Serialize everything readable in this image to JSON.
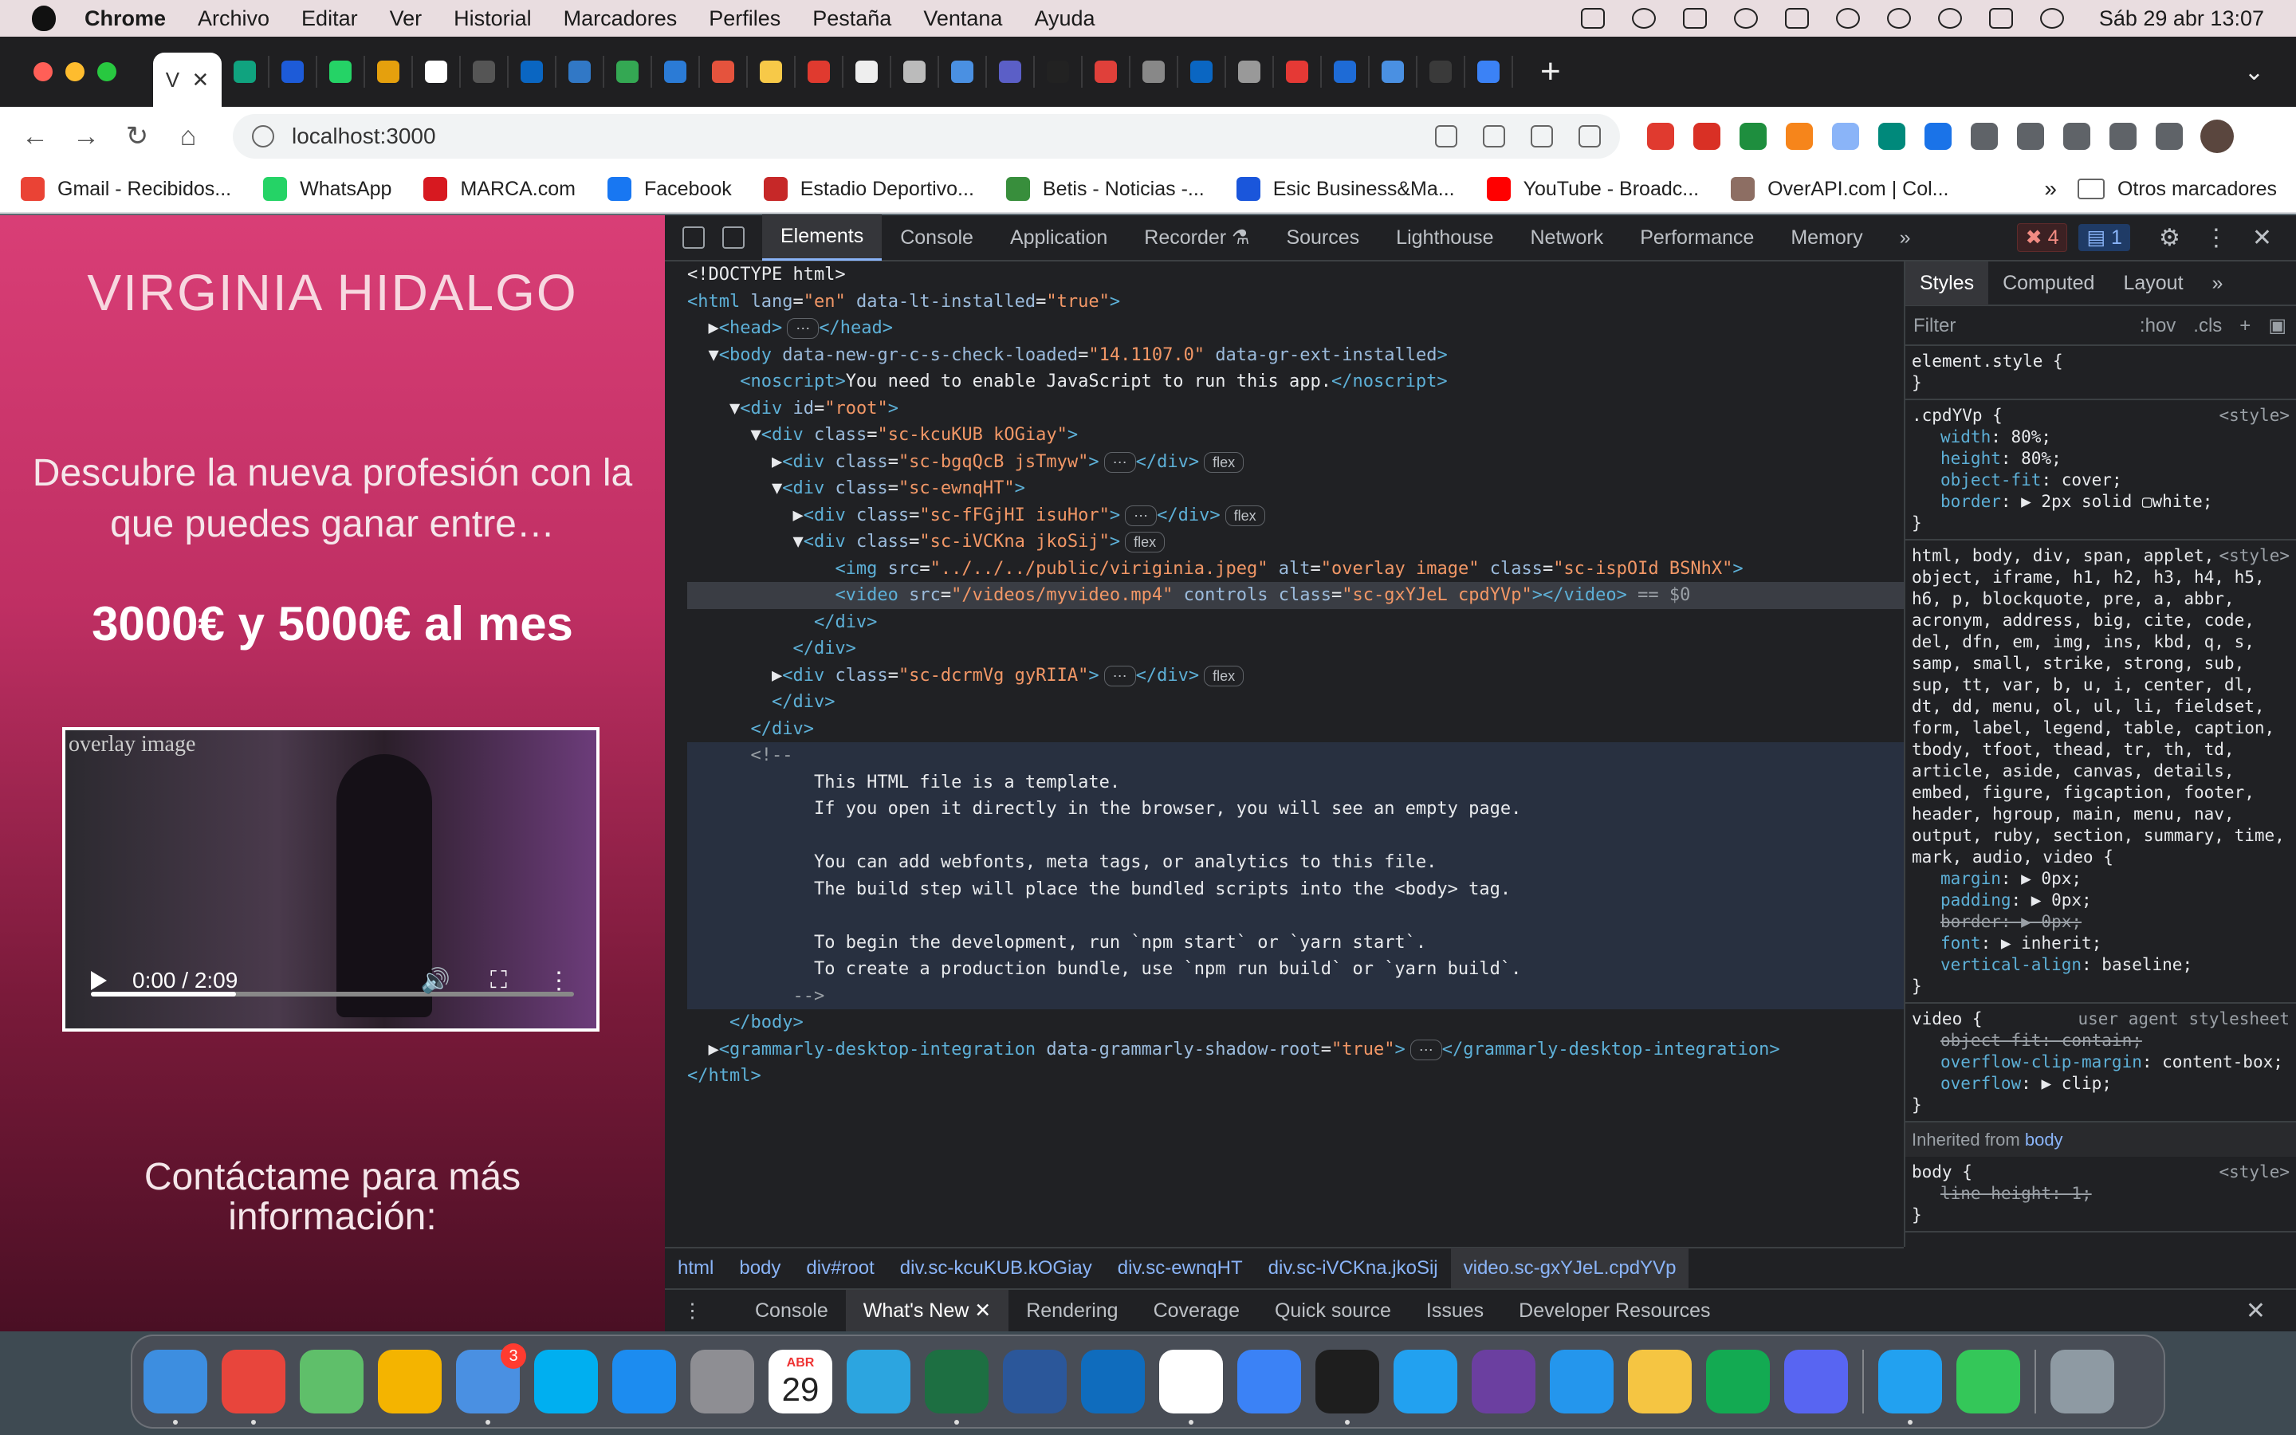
{
  "menubar": {
    "app": "Chrome",
    "items": [
      "Archivo",
      "Editar",
      "Ver",
      "Historial",
      "Marcadores",
      "Perfiles",
      "Pestaña",
      "Ventana",
      "Ayuda"
    ],
    "clock": "Sáb 29 abr 13:07"
  },
  "tabstrip": {
    "active_tab_title": "V",
    "active_tab_close": "✕",
    "new_tab": "+",
    "tab_menu": "⌄",
    "tab_icon_colors": [
      "#10a37f",
      "#1d5bd8",
      "#25d366",
      "#e5a00d",
      "#fff",
      "#555",
      "#0a66c2",
      "#3178c6",
      "#34a853",
      "#2b7bd6",
      "#e5533d",
      "#f7c948",
      "#e03a2f",
      "#eee",
      "#bbb",
      "#4a90e2",
      "#5b5fc7",
      "#222",
      "#e0403a",
      "#888",
      "#0a66c2",
      "#999",
      "#e53935",
      "#1e6bd6",
      "#4a90e2",
      "#3a3a3a",
      "#3b82f6"
    ]
  },
  "toolbar": {
    "url": "localhost:3000",
    "ext_colors": [
      "#e03a2f",
      "#d93025",
      "#1e8e3e",
      "#f6851b",
      "#8ab4f8",
      "#00897b",
      "#1a73e8",
      "#5f6368",
      "#5f6368",
      "#5f6368",
      "#5f6368",
      "#5f6368"
    ]
  },
  "bookmarks": [
    {
      "label": "Gmail - Recibidos...",
      "color": "#ea4335"
    },
    {
      "label": "WhatsApp",
      "color": "#25d366"
    },
    {
      "label": "MARCA.com",
      "color": "#d71920"
    },
    {
      "label": "Facebook",
      "color": "#1877f2"
    },
    {
      "label": "Estadio Deportivo...",
      "color": "#c62828"
    },
    {
      "label": "Betis - Noticias -...",
      "color": "#388e3c"
    },
    {
      "label": "Esic Business&Ma...",
      "color": "#1a56db"
    },
    {
      "label": "YouTube - Broadc...",
      "color": "#ff0000"
    },
    {
      "label": "OverAPI.com | Col...",
      "color": "#8d6e63"
    }
  ],
  "bookmarks_more": "»",
  "bookmarks_folder": "Otros marcadores",
  "page": {
    "name": "VIRGINIA HIDALGO",
    "subtitle": "Descubre la nueva profesión con la que puedes ganar entre…",
    "amount": "3000€ y 5000€ al mes",
    "video_alt": "overlay image",
    "video_time": "0:00 / 2:09",
    "video_progress": 0.3,
    "contact": "Contáctame para más información:"
  },
  "devtools": {
    "tabs": [
      "Elements",
      "Console",
      "Application",
      "Recorder ⚗",
      "Sources",
      "Lighthouse",
      "Network",
      "Performance",
      "Memory"
    ],
    "more_tabs": "»",
    "errors": "✖ 4",
    "messages": "▤ 1",
    "dom_lines": [
      {
        "html": "<span class='txt'>&lt;!DOCTYPE html&gt;</span>"
      },
      {
        "html": "<span class='tag'>&lt;html</span> <span class='attr'>lang</span>=<span class='val'>\"en\"</span> <span class='attr'>data-lt-installed</span>=<span class='val'>\"true\"</span><span class='tag'>&gt;</span>"
      },
      {
        "html": "  <span class='txt'>▶</span><span class='tag'>&lt;head&gt;</span><span class='chip'>⋯</span><span class='tag'>&lt;/head&gt;</span>"
      },
      {
        "html": "  <span class='txt'>▼</span><span class='tag'>&lt;body</span> <span class='attr'>data-new-gr-c-s-check-loaded</span>=<span class='val'>\"14.1107.0\"</span> <span class='attr'>data-gr-ext-installed</span><span class='tag'>&gt;</span>"
      },
      {
        "html": "     <span class='tag'>&lt;noscript&gt;</span><span class='txt'>You need to enable JavaScript to run this app.</span><span class='tag'>&lt;/noscript&gt;</span>"
      },
      {
        "html": "    <span class='txt'>▼</span><span class='tag'>&lt;div</span> <span class='attr'>id</span>=<span class='val'>\"root\"</span><span class='tag'>&gt;</span>"
      },
      {
        "html": "      <span class='txt'>▼</span><span class='tag'>&lt;div</span> <span class='attr'>class</span>=<span class='val'>\"sc-kcuKUB kOGiay\"</span><span class='tag'>&gt;</span>"
      },
      {
        "html": "        <span class='txt'>▶</span><span class='tag'>&lt;div</span> <span class='attr'>class</span>=<span class='val'>\"sc-bgqQcB jsTmyw\"</span><span class='tag'>&gt;</span><span class='chip'>⋯</span><span class='tag'>&lt;/div&gt;</span><span class='chip'>flex</span>"
      },
      {
        "html": "        <span class='txt'>▼</span><span class='tag'>&lt;div</span> <span class='attr'>class</span>=<span class='val'>\"sc-ewnqHT\"</span><span class='tag'>&gt;</span>"
      },
      {
        "html": "          <span class='txt'>▶</span><span class='tag'>&lt;div</span> <span class='attr'>class</span>=<span class='val'>\"sc-fFGjHI isuHor\"</span><span class='tag'>&gt;</span><span class='chip'>⋯</span><span class='tag'>&lt;/div&gt;</span><span class='chip'>flex</span>"
      },
      {
        "html": "          <span class='txt'>▼</span><span class='tag'>&lt;div</span> <span class='attr'>class</span>=<span class='val'>\"sc-iVCKna jkoSij\"</span><span class='tag'>&gt;</span><span class='chip'>flex</span>"
      },
      {
        "html": "              <span class='tag'>&lt;img</span> <span class='attr'>src</span>=<span class='val'>\"../../../public/viriginia.jpeg\"</span> <span class='attr'>alt</span>=<span class='val'>\"overlay image\"</span> <span class='attr'>class</span>=<span class='val'>\"sc-ispOId BSNhX\"</span><span class='tag'>&gt;</span>"
      },
      {
        "sel": true,
        "html": "              <span class='tag'>&lt;video</span> <span class='attr'>src</span>=<span class='val'>\"/videos/myvideo.mp4\"</span> <span class='attr'>controls</span> <span class='attr'>class</span>=<span class='val'>\"sc-gxYJeL cpdYVp\"</span><span class='tag'>&gt;&lt;/video&gt;</span> <span class='cm'>== $0</span>"
      },
      {
        "html": "            <span class='tag'>&lt;/div&gt;</span>"
      },
      {
        "html": "          <span class='tag'>&lt;/div&gt;</span>"
      },
      {
        "html": "        <span class='txt'>▶</span><span class='tag'>&lt;div</span> <span class='attr'>class</span>=<span class='val'>\"sc-dcrmVg gyRIIA\"</span><span class='tag'>&gt;</span><span class='chip'>⋯</span><span class='tag'>&lt;/div&gt;</span><span class='chip'>flex</span>"
      },
      {
        "html": "        <span class='tag'>&lt;/div&gt;</span>"
      },
      {
        "html": "      <span class='tag'>&lt;/div&gt;</span>"
      },
      {
        "cm": true,
        "html": "      <span class='cm'>&lt;!--</span>"
      },
      {
        "cm": true,
        "html": "            <span class='txt'>This HTML file is a template.</span>"
      },
      {
        "cm": true,
        "html": "            <span class='txt'>If you open it directly in the browser, you will see an empty page.</span>"
      },
      {
        "cm": true,
        "html": ""
      },
      {
        "cm": true,
        "html": "            <span class='txt'>You can add webfonts, meta tags, or analytics to this file.</span>"
      },
      {
        "cm": true,
        "html": "            <span class='txt'>The build step will place the bundled scripts into the &lt;body&gt; tag.</span>"
      },
      {
        "cm": true,
        "html": ""
      },
      {
        "cm": true,
        "html": "            <span class='txt'>To begin the development, run `npm start` or `yarn start`.</span>"
      },
      {
        "cm": true,
        "html": "            <span class='txt'>To create a production bundle, use `npm run build` or `yarn build`.</span>"
      },
      {
        "cm": true,
        "html": "          <span class='cm'>--&gt;</span>"
      },
      {
        "html": "    <span class='tag'>&lt;/body&gt;</span>"
      },
      {
        "html": "  <span class='txt'>▶</span><span class='tag'>&lt;grammarly-desktop-integration</span> <span class='attr'>data-grammarly-shadow-root</span>=<span class='val'>\"true\"</span><span class='tag'>&gt;</span><span class='chip'>⋯</span><span class='tag'>&lt;/grammarly-desktop-integration&gt;</span>"
      },
      {
        "html": "<span class='tag'>&lt;/html&gt;</span>"
      }
    ],
    "styles_tabs": [
      "Styles",
      "Computed",
      "Layout",
      "»"
    ],
    "filter_placeholder": "Filter",
    "filter_hov": ":hov",
    "filter_cls": ".cls",
    "filter_plus": "+",
    "breadcrumbs": [
      "html",
      "body",
      "div#root",
      "div.sc-kcuKUB.kOGiay",
      "div.sc-ewnqHT",
      "div.sc-iVCKna.jkoSij",
      "video.sc-gxYJeL.cpdYVp"
    ],
    "drawer_tabs": [
      "Console",
      "What's New ✕",
      "Rendering",
      "Coverage",
      "Quick source",
      "Issues",
      "Developer Resources"
    ],
    "drawer_close": "✕"
  },
  "dock": {
    "apps": [
      {
        "name": "finder",
        "color": "#3d8ee0",
        "dot": true
      },
      {
        "name": "chrome",
        "color": "#e8453c",
        "dot": true
      },
      {
        "name": "maps",
        "color": "#5fbf6a"
      },
      {
        "name": "photos",
        "color": "#f4b400"
      },
      {
        "name": "mail",
        "color": "#4a90e2",
        "badge": "3",
        "dot": true
      },
      {
        "name": "skype",
        "color": "#00aff0"
      },
      {
        "name": "app-store",
        "color": "#1c8cf0"
      },
      {
        "name": "system-settings",
        "color": "#8e8e93"
      },
      {
        "name": "calendar",
        "color": "#ffffff",
        "cal_month": "ABR",
        "cal_day": "29"
      },
      {
        "name": "telegram",
        "color": "#2ca5e0"
      },
      {
        "name": "excel",
        "color": "#1d6f42",
        "dot": true
      },
      {
        "name": "word",
        "color": "#2b579a"
      },
      {
        "name": "outlook",
        "color": "#0f6cbd"
      },
      {
        "name": "slack",
        "color": "#ffffff",
        "dot": true
      },
      {
        "name": "xcode",
        "color": "#3b82f6"
      },
      {
        "name": "terminal",
        "color": "#1e1e1e",
        "dot": true
      },
      {
        "name": "vscode",
        "color": "#22a1f0"
      },
      {
        "name": "tor",
        "color": "#6b3fa0"
      },
      {
        "name": "docker",
        "color": "#2496ed"
      },
      {
        "name": "notes",
        "color": "#f5c542"
      },
      {
        "name": "mongodb",
        "color": "#13aa52"
      },
      {
        "name": "discord",
        "color": "#5865f2"
      },
      {
        "sep": true
      },
      {
        "name": "vscode-2",
        "color": "#22a1f0",
        "dot": true
      },
      {
        "name": "facetime",
        "color": "#34c759"
      },
      {
        "sep": true
      },
      {
        "name": "trash",
        "color": "#8e9aa3"
      }
    ]
  }
}
